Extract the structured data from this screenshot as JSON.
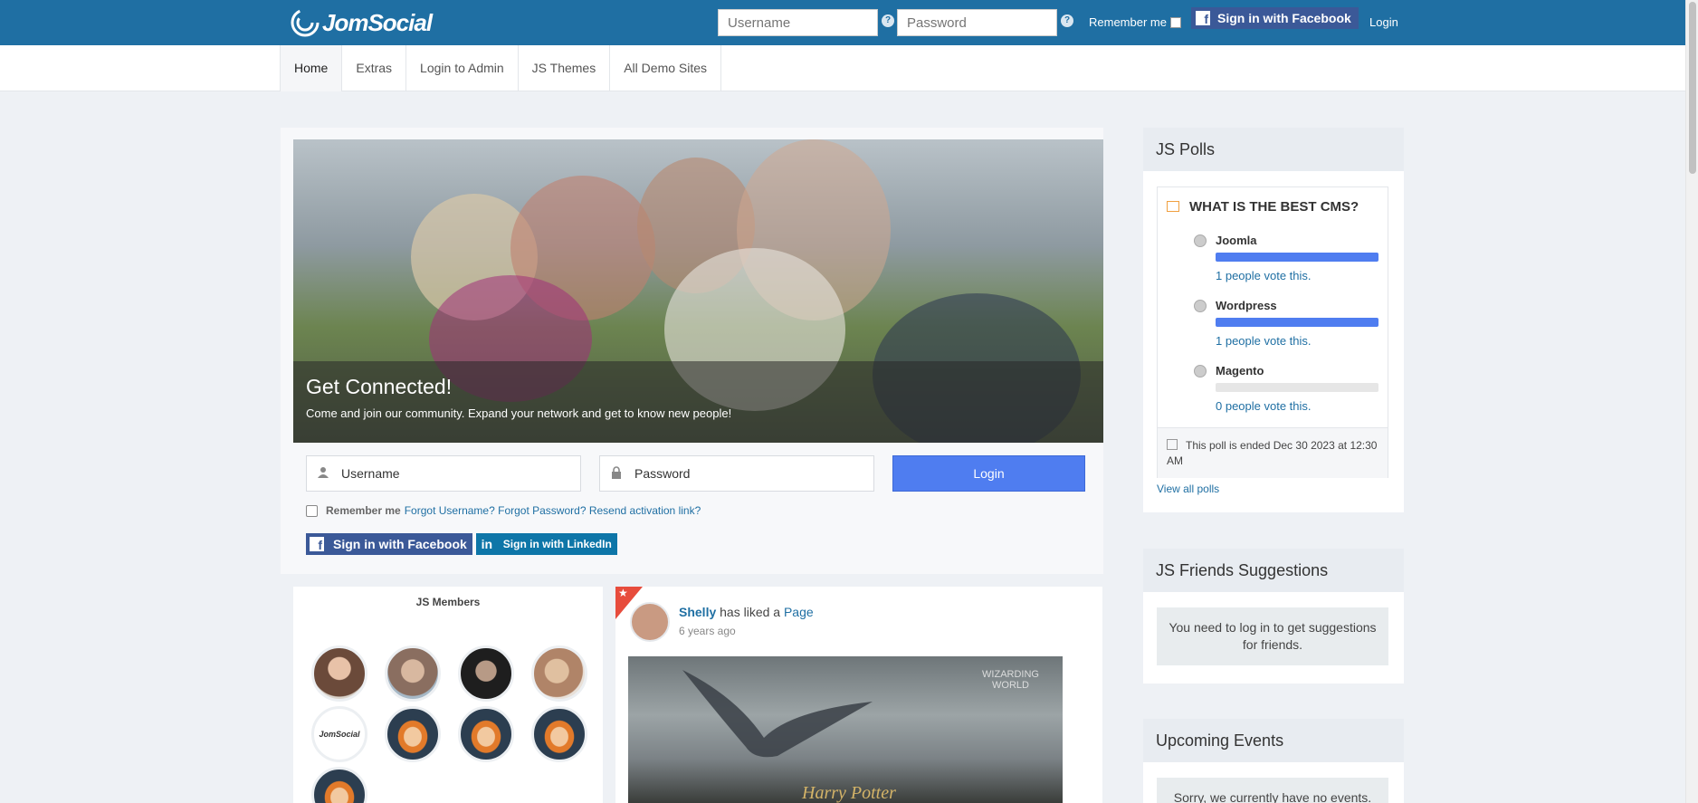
{
  "header": {
    "logo_text": "JomSocial",
    "username_placeholder": "Username",
    "password_placeholder": "Password",
    "help_glyph": "?",
    "remember_label": "Remember me",
    "facebook_label": "Sign in with Facebook",
    "login_label": "Login"
  },
  "nav": {
    "tabs": [
      {
        "label": "Home",
        "active": true
      },
      {
        "label": "Extras"
      },
      {
        "label": "Login to Admin"
      },
      {
        "label": "JS Themes"
      },
      {
        "label": "All Demo Sites"
      }
    ]
  },
  "hero": {
    "title": "Get Connected!",
    "subtitle": "Come and join our community. Expand your network and get to know new people!"
  },
  "login_form": {
    "username_placeholder": "Username",
    "password_placeholder": "Password",
    "login_button": "Login",
    "remember_label": "Remember me",
    "forgot_username": "Forgot Username?",
    "forgot_password": "Forgot Password?",
    "resend_activation": "Resend activation link?",
    "facebook_button": "Sign in with Facebook",
    "linkedin_button": "Sign in with LinkedIn",
    "linkedin_glyph": "in"
  },
  "members": {
    "title": "JS Members",
    "logo_avatar_text": "JomSocial"
  },
  "activity": {
    "actor": "Shelly",
    "action": " has liked a ",
    "object": "Page",
    "time": "6 years ago",
    "image_brand_line1": "WIZARDING",
    "image_brand_line2": "WORLD",
    "image_title": "Harry Potter"
  },
  "polls": {
    "heading": "JS Polls",
    "question": "WHAT IS THE BEST CMS?",
    "options": [
      {
        "name": "Joomla",
        "votes_text": "1 people vote this.",
        "share": 1.0
      },
      {
        "name": "Wordpress",
        "votes_text": "1 people vote this.",
        "share": 1.0
      },
      {
        "name": "Magento",
        "votes_text": "0 people vote this.",
        "share": 0.0
      }
    ],
    "ended_text": "This poll is ended Dec 30 2023 at 12:30 AM",
    "view_all": "View all polls"
  },
  "friends": {
    "heading": "JS Friends Suggestions",
    "message": "You need to log in to get suggestions for friends."
  },
  "events": {
    "heading": "Upcoming Events",
    "message": "Sorry, we currently have no events."
  },
  "colors": {
    "brand": "#1f6fa3",
    "facebook": "#3b5998",
    "linkedin": "#0e76a8",
    "accent": "#4f7df0"
  }
}
